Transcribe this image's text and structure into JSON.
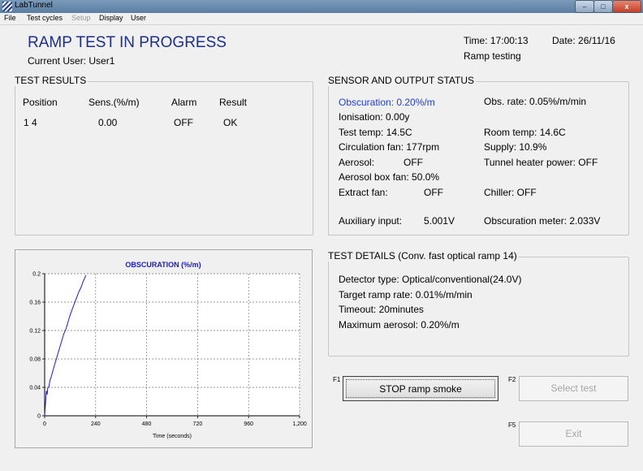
{
  "window": {
    "title": "LabTunnel",
    "minimize": "–",
    "maximize": "□",
    "close": "x"
  },
  "menu": [
    "File",
    "Test cycles",
    "Setup",
    "Display",
    "User"
  ],
  "header": {
    "title": "RAMP TEST IN PROGRESS",
    "current_user": "Current User: User1",
    "time": "Time: 17:00:13",
    "date": "Date: 26/11/16",
    "status": "Ramp testing"
  },
  "test_results": {
    "title": "TEST RESULTS",
    "columns": [
      "Position",
      "Sens.(%/m)",
      "Alarm",
      "Result"
    ],
    "rows": [
      [
        "1 4",
        "0.00",
        "OFF",
        "OK"
      ]
    ]
  },
  "sensor": {
    "title": "SENSOR AND OUTPUT STATUS",
    "obscuration": "Obscuration: 0.20%/m",
    "obs_rate": "Obs. rate: 0.05%/m/min",
    "ionisation": "Ionisation: 0.00y",
    "test_temp": "Test temp: 14.5C",
    "room_temp": "Room temp: 14.6C",
    "circulation_fan": "Circulation fan: 177rpm",
    "supply": "Supply: 10.9%",
    "aerosol_label": "Aerosol:",
    "aerosol_value": "OFF",
    "tunnel_heater": "Tunnel heater power: OFF",
    "aerosol_box_fan": "Aerosol box fan: 50.0%",
    "extract_fan_label": "Extract fan:",
    "extract_fan_value": "OFF",
    "chiller": "Chiller: OFF",
    "aux_label": "Auxiliary input:",
    "aux_value": "5.001V",
    "obs_meter": "Obscuration meter: 2.033V"
  },
  "details": {
    "title": "TEST DETAILS (Conv. fast optical ramp 14)",
    "detector": "Detector type: Optical/conventional(24.0V)",
    "target_rate": "Target ramp rate: 0.01%/m/min",
    "timeout": "Timeout: 20minutes",
    "max_aerosol": "Maximum aerosol: 0.20%/m"
  },
  "buttons": {
    "stop": "STOP ramp smoke",
    "stop_key": "F1",
    "select": "Select test",
    "select_key": "F2",
    "exit": "Exit",
    "exit_key": "F5"
  },
  "chart_data": {
    "type": "line",
    "title": "OBSCURATION (%/m)",
    "xlabel": "Time (seconds)",
    "ylabel": "",
    "xlim": [
      0,
      1200
    ],
    "ylim": [
      0,
      0.2
    ],
    "xticks": [
      0,
      240,
      480,
      720,
      960,
      1200
    ],
    "xtick_labels": [
      "0",
      "240",
      "480",
      "720",
      "960",
      "1,200"
    ],
    "yticks": [
      0,
      0.04,
      0.08,
      0.12,
      0.16,
      0.2
    ],
    "ytick_labels": [
      "0",
      "0.04",
      "0.08",
      "0.12",
      "0.16",
      "0.2"
    ],
    "grid": true,
    "series": [
      {
        "color": "#1c1cc8",
        "x": [
          0,
          5,
          8,
          12,
          15,
          20,
          25,
          30,
          40,
          50,
          60,
          70,
          80,
          90,
          100,
          110,
          120,
          130,
          140,
          150,
          160,
          170,
          180,
          190,
          195
        ],
        "y": [
          0,
          0.022,
          0.035,
          0.03,
          0.04,
          0.04,
          0.05,
          0.054,
          0.065,
          0.075,
          0.085,
          0.095,
          0.105,
          0.115,
          0.122,
          0.132,
          0.142,
          0.15,
          0.158,
          0.166,
          0.174,
          0.18,
          0.188,
          0.195,
          0.198
        ]
      }
    ]
  }
}
